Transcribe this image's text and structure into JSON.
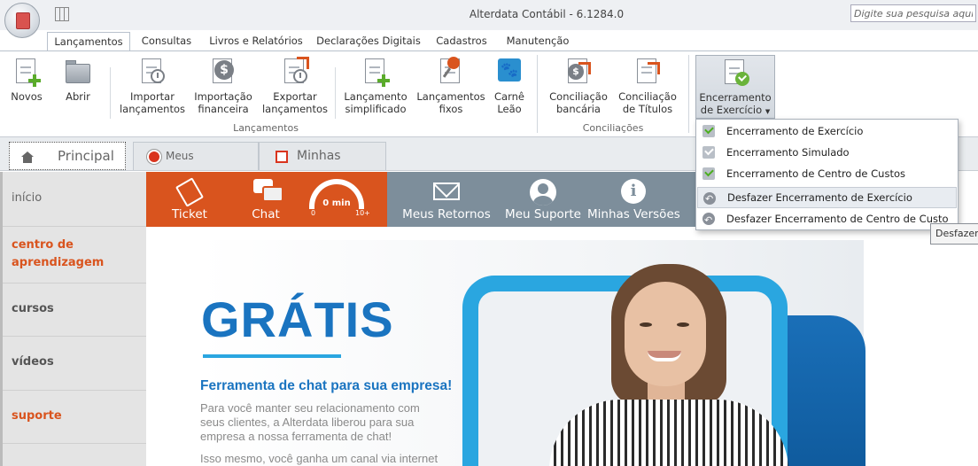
{
  "window": {
    "title": "Alterdata Contábil - 6.1284.0",
    "search_placeholder": "Digite sua pesquisa aqui..."
  },
  "ribbon_tabs": [
    "Lançamentos",
    "Consultas",
    "Livros e Relatórios",
    "Declarações Digitais",
    "Cadastros",
    "Manutenção"
  ],
  "ribbon": {
    "buttons": [
      {
        "line1": "Novos",
        "line2": ""
      },
      {
        "line1": "Abrir",
        "line2": ""
      },
      {
        "line1": "Importar",
        "line2": "lançamentos"
      },
      {
        "line1": "Importação",
        "line2": "financeira"
      },
      {
        "line1": "Exportar",
        "line2": "lançamentos"
      },
      {
        "line1": "Lançamento",
        "line2": "simplificado"
      },
      {
        "line1": "Lançamentos",
        "line2": "fixos"
      },
      {
        "line1": "Carnê",
        "line2": "Leão"
      },
      {
        "line1": "Conciliação",
        "line2": "bancária"
      },
      {
        "line1": "Conciliação",
        "line2": "de Títulos"
      },
      {
        "line1": "Encerramento",
        "line2": "de Exercício"
      }
    ],
    "groups": [
      "Lançamentos",
      "Conciliações"
    ]
  },
  "dropdown": {
    "items": [
      "Encerramento de Exercício",
      "Encerramento Simulado",
      "Encerramento de Centro de Custos",
      "Desfazer Encerramento de Exercício",
      "Desfazer Encerramento de Centro de Custo"
    ],
    "tooltip": "Desfazer E"
  },
  "doc_tabs": [
    "Principal",
    "Meus Atendimentos",
    "Minhas tarefas"
  ],
  "sidebar": {
    "items": [
      "início",
      "centro de",
      "aprendizagem",
      "cursos",
      "vídeos",
      "suporte"
    ]
  },
  "topnav": {
    "ticket": "Ticket",
    "chat": "Chat",
    "gauge_value": "0 min",
    "gauge_min": "0",
    "gauge_max": "10+",
    "retornos": "Meus Retornos",
    "suporte": "Meu Suporte",
    "versoes": "Minhas Versões"
  },
  "banner": {
    "title": "GRÁTIS",
    "headline": "Ferramenta de chat para sua empresa!",
    "body": "Para você manter seu relacionamento com seus clientes, a Alterdata liberou para sua empresa a nossa ferramenta de chat!",
    "body2": "Isso mesmo, você ganha um canal via internet"
  },
  "colors": {
    "accent_orange": "#d9541e",
    "nav_grey": "#7d8e9b",
    "brand_blue": "#1a74c0",
    "light_blue": "#2aa6e0"
  }
}
